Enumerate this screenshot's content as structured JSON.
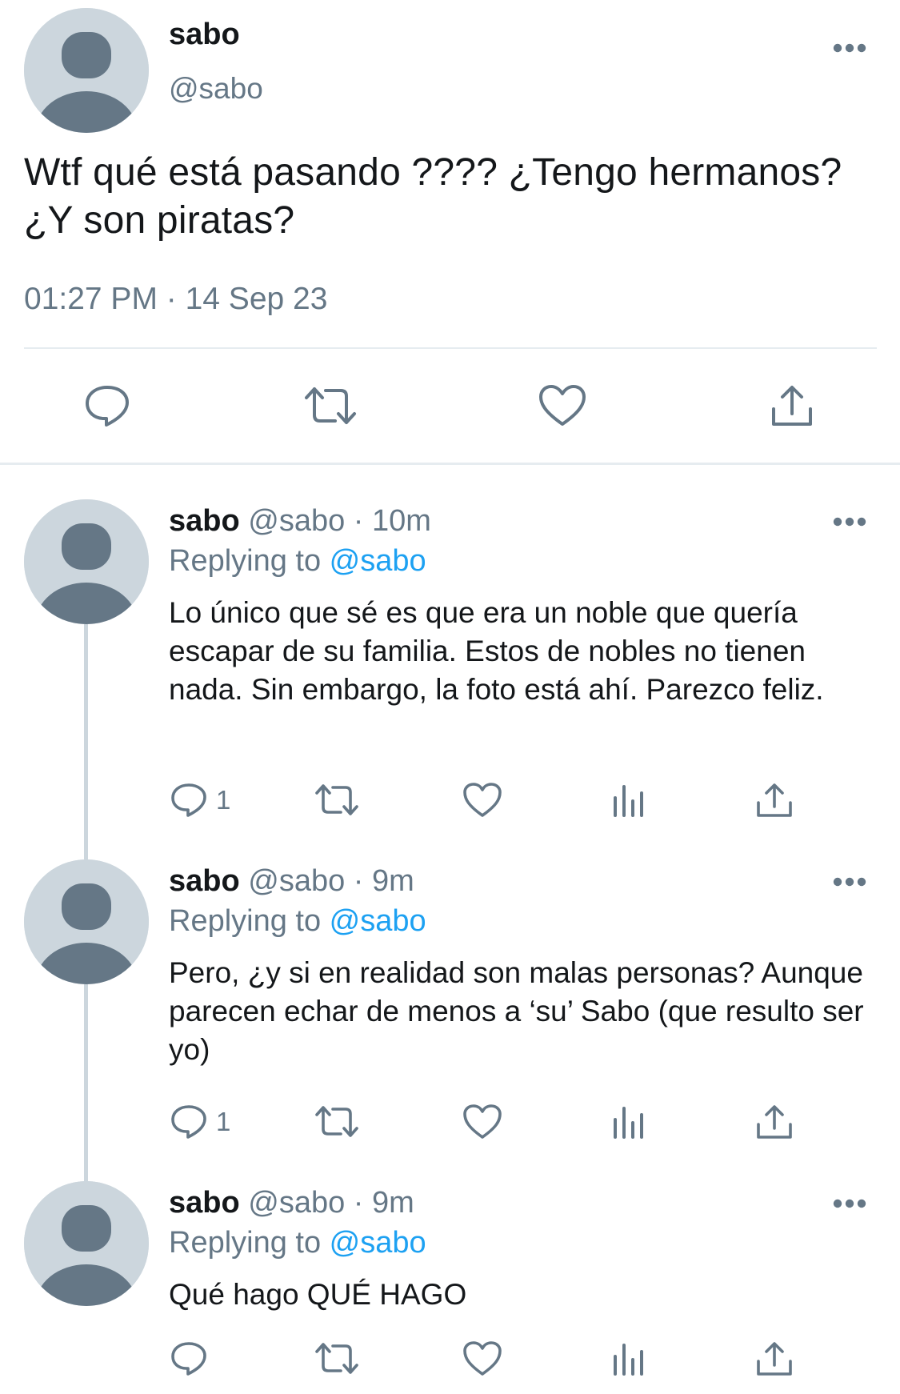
{
  "colors": {
    "text": "#14171a",
    "secondary": "#657786",
    "link": "#1da1f2",
    "avatar_bg": "#ccd6dd",
    "avatar_fg": "#657786",
    "divider": "#e6ecf0"
  },
  "main_tweet": {
    "name": "sabo",
    "handle": "@sabo",
    "text": "Wtf qué está pasando ???? ¿Tengo hermanos? ¿Y son piratas?",
    "timestamp": "01:27 PM · 14 Sep 23",
    "actions": [
      "comment-icon",
      "retweet-icon",
      "heart-icon",
      "share-icon"
    ]
  },
  "replies": [
    {
      "name": "sabo",
      "meta": " @sabo · 10m",
      "replying_label": "Replying to ",
      "replying_handle": "@sabo",
      "text": "Lo único que sé es que era un noble que quería escapar de su familia. Estos de nobles no tienen nada. Sin embargo, la foto está ahí. Parezco feliz.",
      "reply_count": "1"
    },
    {
      "name": "sabo",
      "meta": " @sabo · 9m",
      "replying_label": "Replying to ",
      "replying_handle": "@sabo",
      "text": "Pero, ¿y si en realidad son malas personas? Aunque parecen echar de menos a ‘su’ Sabo (que resulto ser yo)",
      "reply_count": "1"
    },
    {
      "name": "sabo",
      "meta": " @sabo · 9m",
      "replying_label": "Replying to ",
      "replying_handle": "@sabo",
      "text": "Qué hago QUÉ HAGO",
      "reply_count": ""
    }
  ]
}
